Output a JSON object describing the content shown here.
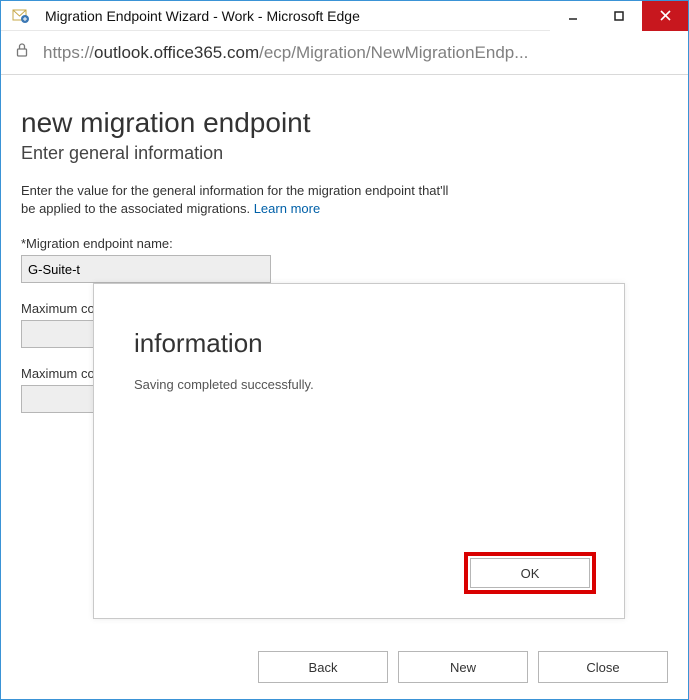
{
  "window": {
    "title": "Migration Endpoint Wizard - Work - Microsoft Edge"
  },
  "address": {
    "host": "outlook.office365.com",
    "prefix": "https://",
    "path": "/ecp/Migration/NewMigrationEndp..."
  },
  "page": {
    "title": "new migration endpoint",
    "subtitle": "Enter general information",
    "intro_text": "Enter the value for the general information for the migration endpoint that'll be applied to the associated migrations. ",
    "learn_more": "Learn more"
  },
  "fields": {
    "name_label": "*Migration endpoint name:",
    "name_value": "G-Suite-t",
    "max1_label": "Maximum concurrent migrations:",
    "max1_value": "",
    "max2_label": "Maximum concurrent incremental syncs:",
    "max2_value": ""
  },
  "footer": {
    "back": "Back",
    "new": "New",
    "close": "Close"
  },
  "modal": {
    "title": "information",
    "message": "Saving completed successfully.",
    "ok": "OK"
  }
}
